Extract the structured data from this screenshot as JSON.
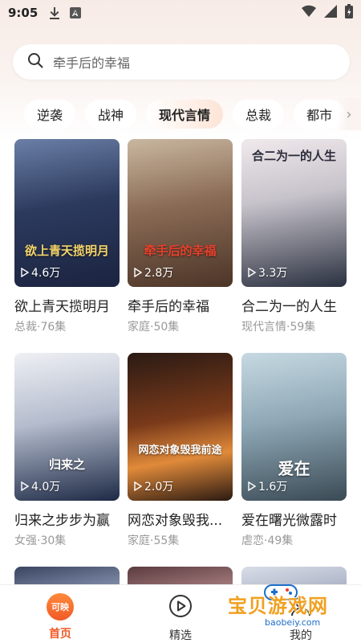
{
  "status_bar": {
    "time": "9:05"
  },
  "search": {
    "placeholder": "牵手后的幸福"
  },
  "categories": [
    {
      "label": "逆袭"
    },
    {
      "label": "战神"
    },
    {
      "label": "现代言情",
      "active": true
    },
    {
      "label": "总裁"
    },
    {
      "label": "都市"
    }
  ],
  "cards": [
    {
      "title": "欲上青天揽明月",
      "meta": "总裁·76集",
      "views": "4.6万",
      "poster_text": "欲上青天揽明月"
    },
    {
      "title": "牵手后的幸福",
      "meta": "家庭·50集",
      "views": "2.8万",
      "poster_text": "牵手后的幸福"
    },
    {
      "title": "合二为一的人生",
      "meta": "现代言情·59集",
      "views": "3.3万",
      "poster_text": "合二为一的人生"
    },
    {
      "title": "归来之步步为赢",
      "meta": "女强·30集",
      "views": "4.0万",
      "poster_text": "归来之"
    },
    {
      "title": "网恋对象毁我...",
      "meta": "家庭·55集",
      "views": "2.0万",
      "poster_text": "网恋对象毁我前途"
    },
    {
      "title": "爱在曙光微露时",
      "meta": "虐恋·49集",
      "views": "1.6万",
      "poster_text": "爱在"
    }
  ],
  "bottom_nav": [
    {
      "label": "首页",
      "icon": "app-logo-icon",
      "badge": "可映",
      "active": true
    },
    {
      "label": "精选",
      "icon": "play-circle-icon"
    },
    {
      "label": "我的",
      "icon": "user-icon"
    }
  ],
  "watermark": {
    "text": "宝贝游戏网",
    "url": "baobeiy.com"
  },
  "colors": {
    "accent": "#f05a28",
    "header_bg": "#f7ebe6",
    "meta_text": "#999999"
  }
}
